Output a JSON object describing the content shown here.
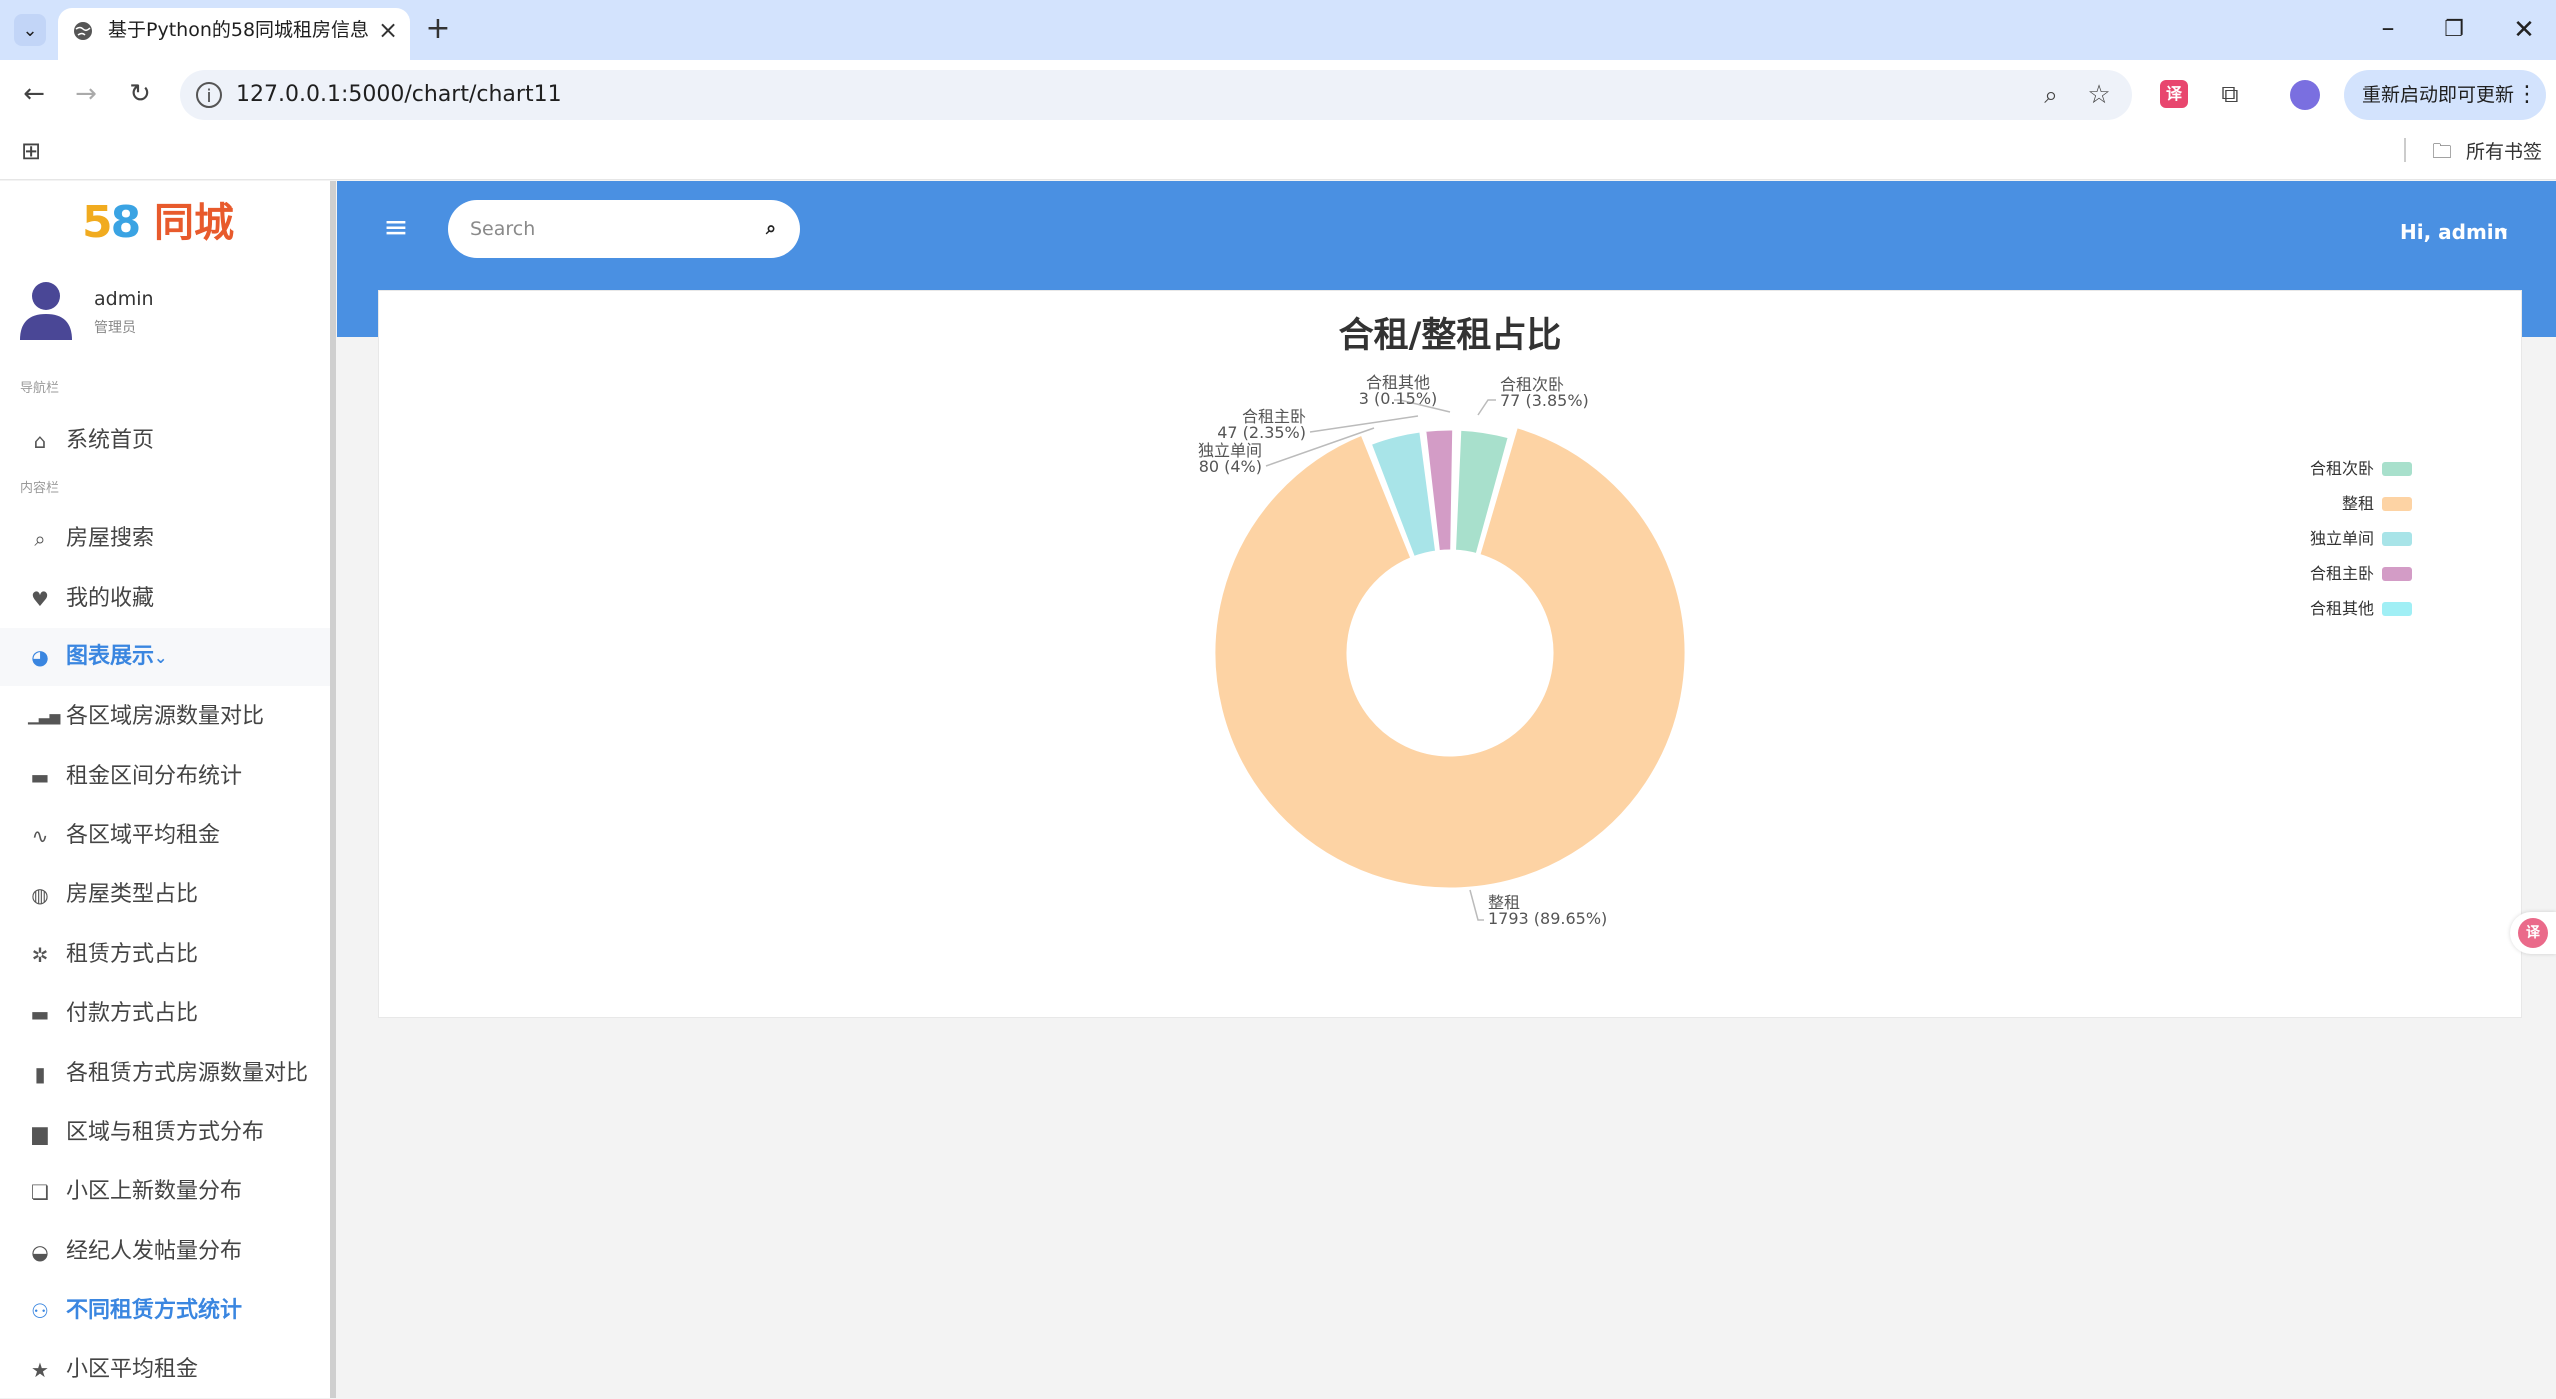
{
  "browser": {
    "tab_title": "基于Python的58同城租房信息",
    "url": "127.0.0.1:5000/chart/chart11",
    "update_button": "重新启动即可更新",
    "bookmark_folder": "所有书签"
  },
  "sidebar": {
    "logo_num": "58",
    "logo_text": "同城",
    "user_name": "admin",
    "user_role": "管理员",
    "section_nav": "导航栏",
    "section_content": "内容栏",
    "items": [
      {
        "label": "系统首页",
        "icon": "home-icon"
      },
      {
        "label": "房屋搜索",
        "icon": "search-icon"
      },
      {
        "label": "我的收藏",
        "icon": "heart-icon"
      },
      {
        "label": "图表展示",
        "icon": "pie-chart-icon"
      },
      {
        "label": "各区域房源数量对比",
        "icon": "signal-bars-icon"
      },
      {
        "label": "租金区间分布统计",
        "icon": "keyboard-icon"
      },
      {
        "label": "各区域平均租金",
        "icon": "pulse-icon"
      },
      {
        "label": "房屋类型占比",
        "icon": "gamepad-icon"
      },
      {
        "label": "租赁方式占比",
        "icon": "snowflake-icon"
      },
      {
        "label": "付款方式占比",
        "icon": "keyboard-icon"
      },
      {
        "label": "各租赁方式房源数量对比",
        "icon": "book-icon"
      },
      {
        "label": "区域与租赁方式分布",
        "icon": "calendar-icon"
      },
      {
        "label": "小区上新数量分布",
        "icon": "comments-icon"
      },
      {
        "label": "经纪人发帖量分布",
        "icon": "gauge-icon"
      },
      {
        "label": "不同租赁方式统计",
        "icon": "users-icon"
      },
      {
        "label": "小区平均租金",
        "icon": "star-icon"
      }
    ]
  },
  "header": {
    "search_placeholder": "Search",
    "user_greeting": "Hi, admin"
  },
  "colors": {
    "header_blue": "#4a90e2",
    "active_blue": "#3a86e0"
  },
  "chart_data": {
    "type": "pie",
    "title": "合租/整租占比",
    "donut": true,
    "legend_position": "right",
    "slices": [
      {
        "name": "合租次卧",
        "value": 77,
        "label": "77 (3.85%)",
        "color": "#a8e0cc"
      },
      {
        "name": "整租",
        "value": 1793,
        "label": "1793 (89.65%)",
        "color": "#fdd3a4"
      },
      {
        "name": "独立单间",
        "value": 80,
        "label": "80 (4%)",
        "color": "#a8e4e8"
      },
      {
        "name": "合租主卧",
        "value": 47,
        "label": "47 (2.35%)",
        "color": "#d39cc6"
      },
      {
        "name": "合租其他",
        "value": 3,
        "label": "3 (0.15%)",
        "color": "#a0eff5"
      }
    ]
  }
}
